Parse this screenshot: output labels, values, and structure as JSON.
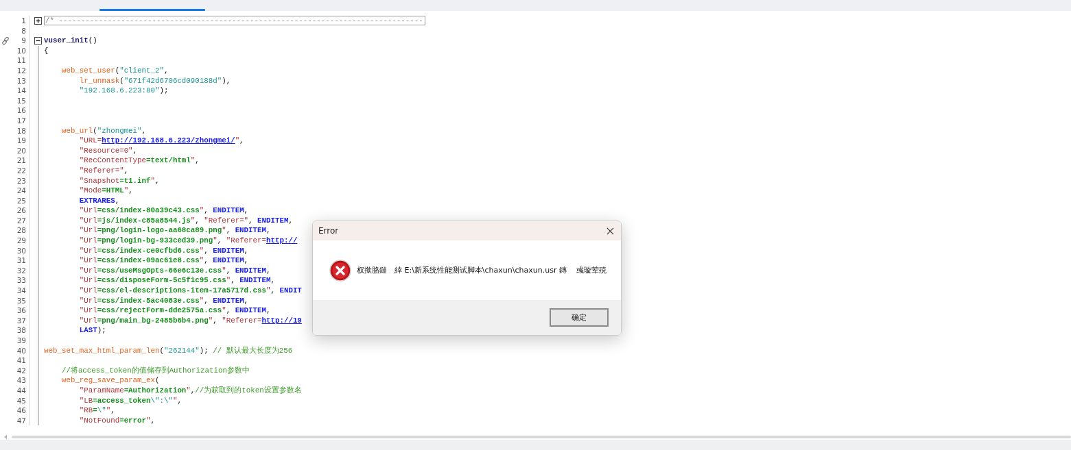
{
  "editor": {
    "lines": [
      {
        "n": "1",
        "expanded": false,
        "folded": true,
        "t": [
          {
            "kind": "comment",
            "text": "/* ----------------------------------------------------------------------------------"
          }
        ]
      },
      {
        "n": "8"
      },
      {
        "n": "9",
        "expanded": true,
        "marked": true,
        "t": [
          {
            "kind": "identifier",
            "text": "vuser_init"
          },
          {
            "kind": "punct",
            "text": "()"
          }
        ]
      },
      {
        "n": "10",
        "t": [
          {
            "kind": "punct",
            "text": "{"
          }
        ]
      },
      {
        "n": "11"
      },
      {
        "n": "12",
        "t": [
          {
            "kind": "function",
            "text": "    web_set_user"
          },
          {
            "kind": "punct",
            "text": "("
          },
          {
            "kind": "string",
            "text": "\"client_2\""
          },
          {
            "kind": "punct",
            "text": ","
          }
        ]
      },
      {
        "n": "13",
        "t": [
          {
            "kind": "function",
            "text": "        lr_unmask"
          },
          {
            "kind": "punct",
            "text": "("
          },
          {
            "kind": "string",
            "text": "\"671f42d6706cd090188d\""
          },
          {
            "kind": "punct",
            "text": "),"
          }
        ]
      },
      {
        "n": "14",
        "t": [
          {
            "kind": "string",
            "text": "        \"192.168.6.223:80\""
          },
          {
            "kind": "punct",
            "text": ");"
          }
        ]
      },
      {
        "n": "15"
      },
      {
        "n": "16"
      },
      {
        "n": "17"
      },
      {
        "n": "18",
        "t": [
          {
            "kind": "function",
            "text": "    web_url"
          },
          {
            "kind": "punct",
            "text": "("
          },
          {
            "kind": "string",
            "text": "\"zhongmei\""
          },
          {
            "kind": "punct",
            "text": ","
          }
        ]
      },
      {
        "n": "19",
        "t": [
          {
            "kind": "key",
            "text": "        \"URL="
          },
          {
            "kind": "link",
            "text": "http://192.168.6.223/zhongmei/"
          },
          {
            "kind": "key",
            "text": "\""
          },
          {
            "kind": "punct",
            "text": ","
          }
        ]
      },
      {
        "n": "20",
        "t": [
          {
            "kind": "key",
            "text": "        \"Resource=0\""
          },
          {
            "kind": "punct",
            "text": ","
          }
        ]
      },
      {
        "n": "21",
        "t": [
          {
            "kind": "key",
            "text": "        \"RecContentType"
          },
          {
            "kind": "value",
            "text": "=text/html"
          },
          {
            "kind": "key",
            "text": "\""
          },
          {
            "kind": "punct",
            "text": ","
          }
        ]
      },
      {
        "n": "22",
        "t": [
          {
            "kind": "key",
            "text": "        \"Referer=\""
          },
          {
            "kind": "punct",
            "text": ","
          }
        ]
      },
      {
        "n": "23",
        "t": [
          {
            "kind": "key",
            "text": "        \"Snapshot"
          },
          {
            "kind": "value",
            "text": "=t1.inf"
          },
          {
            "kind": "key",
            "text": "\""
          },
          {
            "kind": "punct",
            "text": ","
          }
        ]
      },
      {
        "n": "24",
        "t": [
          {
            "kind": "key",
            "text": "        \"Mode"
          },
          {
            "kind": "value",
            "text": "=HTML"
          },
          {
            "kind": "key",
            "text": "\""
          },
          {
            "kind": "punct",
            "text": ","
          }
        ]
      },
      {
        "n": "25",
        "t": [
          {
            "kind": "keyword",
            "text": "        EXTRARES"
          },
          {
            "kind": "punct",
            "text": ","
          }
        ]
      },
      {
        "n": "26",
        "t": [
          {
            "kind": "key",
            "text": "        \"Url"
          },
          {
            "kind": "value",
            "text": "=css/index-80a39c43.css"
          },
          {
            "kind": "key",
            "text": "\""
          },
          {
            "kind": "punct",
            "text": ", "
          },
          {
            "kind": "keyword",
            "text": "ENDITEM"
          },
          {
            "kind": "punct",
            "text": ","
          }
        ]
      },
      {
        "n": "27",
        "t": [
          {
            "kind": "key",
            "text": "        \"Url"
          },
          {
            "kind": "value",
            "text": "=js/index-c85a8544.js"
          },
          {
            "kind": "key",
            "text": "\""
          },
          {
            "kind": "punct",
            "text": ", "
          },
          {
            "kind": "key",
            "text": "\"Referer=\""
          },
          {
            "kind": "punct",
            "text": ", "
          },
          {
            "kind": "keyword",
            "text": "ENDITEM"
          },
          {
            "kind": "punct",
            "text": ","
          }
        ]
      },
      {
        "n": "28",
        "t": [
          {
            "kind": "key",
            "text": "        \"Url"
          },
          {
            "kind": "value",
            "text": "=png/login-logo-aa68ca89.png"
          },
          {
            "kind": "key",
            "text": "\""
          },
          {
            "kind": "punct",
            "text": ", "
          },
          {
            "kind": "keyword",
            "text": "ENDITEM"
          },
          {
            "kind": "punct",
            "text": ","
          }
        ]
      },
      {
        "n": "29",
        "t": [
          {
            "kind": "key",
            "text": "        \"Url"
          },
          {
            "kind": "value",
            "text": "=png/login-bg-933ced39.png"
          },
          {
            "kind": "key",
            "text": "\""
          },
          {
            "kind": "punct",
            "text": ", "
          },
          {
            "kind": "key",
            "text": "\"Referer="
          },
          {
            "kind": "link",
            "text": "http://"
          }
        ]
      },
      {
        "n": "30",
        "t": [
          {
            "kind": "key",
            "text": "        \"Url"
          },
          {
            "kind": "value",
            "text": "=css/index-ce0cfbd6.css"
          },
          {
            "kind": "key",
            "text": "\""
          },
          {
            "kind": "punct",
            "text": ", "
          },
          {
            "kind": "keyword",
            "text": "ENDITEM"
          },
          {
            "kind": "punct",
            "text": ","
          }
        ]
      },
      {
        "n": "31",
        "t": [
          {
            "kind": "key",
            "text": "        \"Url"
          },
          {
            "kind": "value",
            "text": "=css/index-09ac61e8.css"
          },
          {
            "kind": "key",
            "text": "\""
          },
          {
            "kind": "punct",
            "text": ", "
          },
          {
            "kind": "keyword",
            "text": "ENDITEM"
          },
          {
            "kind": "punct",
            "text": ","
          }
        ]
      },
      {
        "n": "32",
        "t": [
          {
            "kind": "key",
            "text": "        \"Url"
          },
          {
            "kind": "value",
            "text": "=css/useMsgOpts-66e6c13e.css"
          },
          {
            "kind": "key",
            "text": "\""
          },
          {
            "kind": "punct",
            "text": ", "
          },
          {
            "kind": "keyword",
            "text": "ENDITEM"
          },
          {
            "kind": "punct",
            "text": ","
          }
        ]
      },
      {
        "n": "33",
        "t": [
          {
            "kind": "key",
            "text": "        \"Url"
          },
          {
            "kind": "value",
            "text": "=css/disposeForm-5c5f1c95.css"
          },
          {
            "kind": "key",
            "text": "\""
          },
          {
            "kind": "punct",
            "text": ", "
          },
          {
            "kind": "keyword",
            "text": "ENDITEM"
          },
          {
            "kind": "punct",
            "text": ","
          }
        ]
      },
      {
        "n": "34",
        "t": [
          {
            "kind": "key",
            "text": "        \"Url"
          },
          {
            "kind": "value",
            "text": "=css/el-descriptions-item-17a5717d.css"
          },
          {
            "kind": "key",
            "text": "\""
          },
          {
            "kind": "punct",
            "text": ", "
          },
          {
            "kind": "keyword",
            "text": "ENDIT"
          }
        ]
      },
      {
        "n": "35",
        "t": [
          {
            "kind": "key",
            "text": "        \"Url"
          },
          {
            "kind": "value",
            "text": "=css/index-5ac4083e.css"
          },
          {
            "kind": "key",
            "text": "\""
          },
          {
            "kind": "punct",
            "text": ", "
          },
          {
            "kind": "keyword",
            "text": "ENDITEM"
          },
          {
            "kind": "punct",
            "text": ","
          }
        ]
      },
      {
        "n": "36",
        "t": [
          {
            "kind": "key",
            "text": "        \"Url"
          },
          {
            "kind": "value",
            "text": "=css/rejectForm-dde2575a.css"
          },
          {
            "kind": "key",
            "text": "\""
          },
          {
            "kind": "punct",
            "text": ", "
          },
          {
            "kind": "keyword",
            "text": "ENDITEM"
          },
          {
            "kind": "punct",
            "text": ","
          }
        ]
      },
      {
        "n": "37",
        "t": [
          {
            "kind": "key",
            "text": "        \"Url"
          },
          {
            "kind": "value",
            "text": "=png/main_bg-2485b6b4.png"
          },
          {
            "kind": "key",
            "text": "\""
          },
          {
            "kind": "punct",
            "text": ", "
          },
          {
            "kind": "key",
            "text": "\"Referer="
          },
          {
            "kind": "link",
            "text": "http://19"
          }
        ]
      },
      {
        "n": "38",
        "t": [
          {
            "kind": "keyword",
            "text": "        LAST"
          },
          {
            "kind": "punct",
            "text": ");"
          }
        ]
      },
      {
        "n": "39"
      },
      {
        "n": "40",
        "t": [
          {
            "kind": "function",
            "text": "web_set_max_html_param_len"
          },
          {
            "kind": "punct",
            "text": "("
          },
          {
            "kind": "string",
            "text": "\"262144\""
          },
          {
            "kind": "punct",
            "text": "); "
          },
          {
            "kind": "comment",
            "text": "// 默认最大长度为256"
          }
        ]
      },
      {
        "n": "41"
      },
      {
        "n": "42",
        "t": [
          {
            "kind": "comment",
            "text": "    //将access_token的值储存到Authorization参数中"
          }
        ]
      },
      {
        "n": "43",
        "t": [
          {
            "kind": "function",
            "text": "    web_reg_save_param_ex"
          },
          {
            "kind": "punct",
            "text": "("
          }
        ]
      },
      {
        "n": "44",
        "t": [
          {
            "kind": "key",
            "text": "        \"ParamName"
          },
          {
            "kind": "value",
            "text": "=Authorization"
          },
          {
            "kind": "key",
            "text": "\""
          },
          {
            "kind": "punct",
            "text": ","
          },
          {
            "kind": "comment",
            "text": "//为获取到的token设置参数名"
          }
        ]
      },
      {
        "n": "45",
        "t": [
          {
            "kind": "key",
            "text": "        \"LB"
          },
          {
            "kind": "value",
            "text": "=access_token"
          },
          {
            "kind": "string",
            "text": "\\\":\\\""
          },
          {
            "kind": "key",
            "text": "\""
          },
          {
            "kind": "punct",
            "text": ","
          }
        ]
      },
      {
        "n": "46",
        "t": [
          {
            "kind": "key",
            "text": "        \"RB"
          },
          {
            "kind": "value",
            "text": "="
          },
          {
            "kind": "string",
            "text": "\\\""
          },
          {
            "kind": "key",
            "text": "\""
          },
          {
            "kind": "punct",
            "text": ","
          }
        ]
      },
      {
        "n": "47",
        "t": [
          {
            "kind": "key",
            "text": "        \"NotFound"
          },
          {
            "kind": "value",
            "text": "=error"
          },
          {
            "kind": "key",
            "text": "\""
          },
          {
            "kind": "punct",
            "text": ","
          }
        ]
      }
    ]
  },
  "dialog": {
    "title": "Error",
    "message": "权揿胳鏈　緈 E:\\新系统性能测试脚本\\chaxun\\chaxun.usr 鏄　 彧璇荤殑",
    "buttons": [
      {
        "label": "确定",
        "default": true
      }
    ]
  }
}
